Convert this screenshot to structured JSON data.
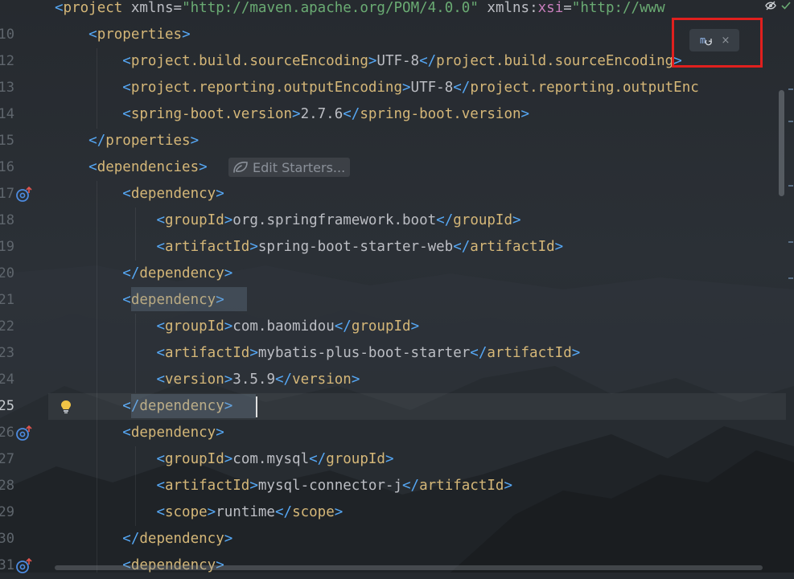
{
  "editor": {
    "lines": [
      {
        "num": "",
        "segs": [
          [
            "pn",
            "<"
          ],
          [
            "tg",
            "project"
          ],
          [
            "tx",
            " "
          ],
          [
            "at",
            "xmlns"
          ],
          [
            "tx",
            "="
          ],
          [
            "sv",
            "\"http://maven.apache.org/POM/4.0.0\""
          ],
          [
            "tx",
            " "
          ],
          [
            "at",
            "xmlns"
          ],
          [
            "tx",
            ":"
          ],
          [
            "ns",
            "xsi"
          ],
          [
            "tx",
            "="
          ],
          [
            "sv",
            "\"http://www"
          ]
        ]
      },
      {
        "num": "10",
        "segs": [
          [
            "tx",
            "    "
          ],
          [
            "pn",
            "<"
          ],
          [
            "tg",
            "properties"
          ],
          [
            "pn",
            ">"
          ]
        ]
      },
      {
        "num": "12",
        "segs": [
          [
            "tx",
            "        "
          ],
          [
            "pn",
            "<"
          ],
          [
            "tg",
            "project.build.sourceEncoding"
          ],
          [
            "pn",
            ">"
          ],
          [
            "tx",
            "UTF-8"
          ],
          [
            "pn",
            "</"
          ],
          [
            "tg",
            "project.build.sourceEncoding"
          ],
          [
            "pn",
            ">"
          ]
        ]
      },
      {
        "num": "13",
        "segs": [
          [
            "tx",
            "        "
          ],
          [
            "pn",
            "<"
          ],
          [
            "tg",
            "project.reporting.outputEncoding"
          ],
          [
            "pn",
            ">"
          ],
          [
            "tx",
            "UTF-8"
          ],
          [
            "pn",
            "</"
          ],
          [
            "tg",
            "project.reporting.outputEnc"
          ]
        ]
      },
      {
        "num": "14",
        "segs": [
          [
            "tx",
            "        "
          ],
          [
            "pn",
            "<"
          ],
          [
            "tg",
            "spring-boot.version"
          ],
          [
            "pn",
            ">"
          ],
          [
            "tx",
            "2.7.6"
          ],
          [
            "pn",
            "</"
          ],
          [
            "tg",
            "spring-boot.version"
          ],
          [
            "pn",
            ">"
          ]
        ]
      },
      {
        "num": "15",
        "segs": [
          [
            "tx",
            "    "
          ],
          [
            "pn",
            "</"
          ],
          [
            "tg",
            "properties"
          ],
          [
            "pn",
            ">"
          ]
        ]
      },
      {
        "num": "16",
        "segs": [
          [
            "tx",
            "    "
          ],
          [
            "pn",
            "<"
          ],
          [
            "tg",
            "dependencies"
          ],
          [
            "pn",
            ">"
          ]
        ]
      },
      {
        "num": "17",
        "segs": [
          [
            "tx",
            "        "
          ],
          [
            "pn",
            "<"
          ],
          [
            "tg",
            "dependency"
          ],
          [
            "pn",
            ">"
          ]
        ]
      },
      {
        "num": "18",
        "segs": [
          [
            "tx",
            "            "
          ],
          [
            "pn",
            "<"
          ],
          [
            "tg",
            "groupId"
          ],
          [
            "pn",
            ">"
          ],
          [
            "tx",
            "org.springframework.boot"
          ],
          [
            "pn",
            "</"
          ],
          [
            "tg",
            "groupId"
          ],
          [
            "pn",
            ">"
          ]
        ]
      },
      {
        "num": "19",
        "segs": [
          [
            "tx",
            "            "
          ],
          [
            "pn",
            "<"
          ],
          [
            "tg",
            "artifactId"
          ],
          [
            "pn",
            ">"
          ],
          [
            "tx",
            "spring-boot-starter-web"
          ],
          [
            "pn",
            "</"
          ],
          [
            "tg",
            "artifactId"
          ],
          [
            "pn",
            ">"
          ]
        ]
      },
      {
        "num": "20",
        "segs": [
          [
            "tx",
            "        "
          ],
          [
            "pn",
            "</"
          ],
          [
            "tg",
            "dependency"
          ],
          [
            "pn",
            ">"
          ]
        ]
      },
      {
        "num": "21",
        "segs": [
          [
            "tx",
            "        "
          ],
          [
            "pn",
            "<"
          ],
          [
            "tg",
            "dependency"
          ],
          [
            "pn",
            ">"
          ]
        ]
      },
      {
        "num": "22",
        "segs": [
          [
            "tx",
            "            "
          ],
          [
            "pn",
            "<"
          ],
          [
            "tg",
            "groupId"
          ],
          [
            "pn",
            ">"
          ],
          [
            "tx",
            "com.baomidou"
          ],
          [
            "pn",
            "</"
          ],
          [
            "tg",
            "groupId"
          ],
          [
            "pn",
            ">"
          ]
        ]
      },
      {
        "num": "23",
        "segs": [
          [
            "tx",
            "            "
          ],
          [
            "pn",
            "<"
          ],
          [
            "tg",
            "artifactId"
          ],
          [
            "pn",
            ">"
          ],
          [
            "tx",
            "mybatis-plus-boot-starter"
          ],
          [
            "pn",
            "</"
          ],
          [
            "tg",
            "artifactId"
          ],
          [
            "pn",
            ">"
          ]
        ]
      },
      {
        "num": "24",
        "segs": [
          [
            "tx",
            "            "
          ],
          [
            "pn",
            "<"
          ],
          [
            "tg",
            "version"
          ],
          [
            "pn",
            ">"
          ],
          [
            "tx",
            "3.5.9"
          ],
          [
            "pn",
            "</"
          ],
          [
            "tg",
            "version"
          ],
          [
            "pn",
            ">"
          ]
        ]
      },
      {
        "num": "25",
        "segs": [
          [
            "tx",
            "        "
          ],
          [
            "pn",
            "</"
          ],
          [
            "tg",
            "dependency"
          ],
          [
            "pn",
            ">"
          ]
        ]
      },
      {
        "num": "26",
        "segs": [
          [
            "tx",
            "        "
          ],
          [
            "pn",
            "<"
          ],
          [
            "tg",
            "dependency"
          ],
          [
            "pn",
            ">"
          ]
        ]
      },
      {
        "num": "27",
        "segs": [
          [
            "tx",
            "            "
          ],
          [
            "pn",
            "<"
          ],
          [
            "tg",
            "groupId"
          ],
          [
            "pn",
            ">"
          ],
          [
            "tx",
            "com.mysql"
          ],
          [
            "pn",
            "</"
          ],
          [
            "tg",
            "groupId"
          ],
          [
            "pn",
            ">"
          ]
        ]
      },
      {
        "num": "28",
        "segs": [
          [
            "tx",
            "            "
          ],
          [
            "pn",
            "<"
          ],
          [
            "tg",
            "artifactId"
          ],
          [
            "pn",
            ">"
          ],
          [
            "tx",
            "mysql-connector-j"
          ],
          [
            "pn",
            "</"
          ],
          [
            "tg",
            "artifactId"
          ],
          [
            "pn",
            ">"
          ]
        ]
      },
      {
        "num": "29",
        "segs": [
          [
            "tx",
            "            "
          ],
          [
            "pn",
            "<"
          ],
          [
            "tg",
            "scope"
          ],
          [
            "pn",
            ">"
          ],
          [
            "tx",
            "runtime"
          ],
          [
            "pn",
            "</"
          ],
          [
            "tg",
            "scope"
          ],
          [
            "pn",
            ">"
          ]
        ]
      },
      {
        "num": "30",
        "segs": [
          [
            "tx",
            "        "
          ],
          [
            "pn",
            "</"
          ],
          [
            "tg",
            "dependency"
          ],
          [
            "pn",
            ">"
          ]
        ]
      },
      {
        "num": "31",
        "segs": [
          [
            "tx",
            "        "
          ],
          [
            "pn",
            "<"
          ],
          [
            "tg",
            "dependency"
          ],
          [
            "pn",
            ">"
          ]
        ]
      }
    ],
    "current_line_index": 15
  },
  "inlay_hint": {
    "label": "Edit Starters..."
  },
  "gutter_icons": {
    "run_markers": [
      7,
      16,
      21
    ],
    "bulb_line": 15
  },
  "float_toolbar": {
    "reload_icon": "maven-reload-icon",
    "close_label": "×"
  },
  "colors": {
    "tag": "#d5b778",
    "bracket": "#56a8f5",
    "string": "#6aab73",
    "namespace": "#c77dbb",
    "text": "#bcbec4",
    "highlight_box": "#e0201e"
  }
}
